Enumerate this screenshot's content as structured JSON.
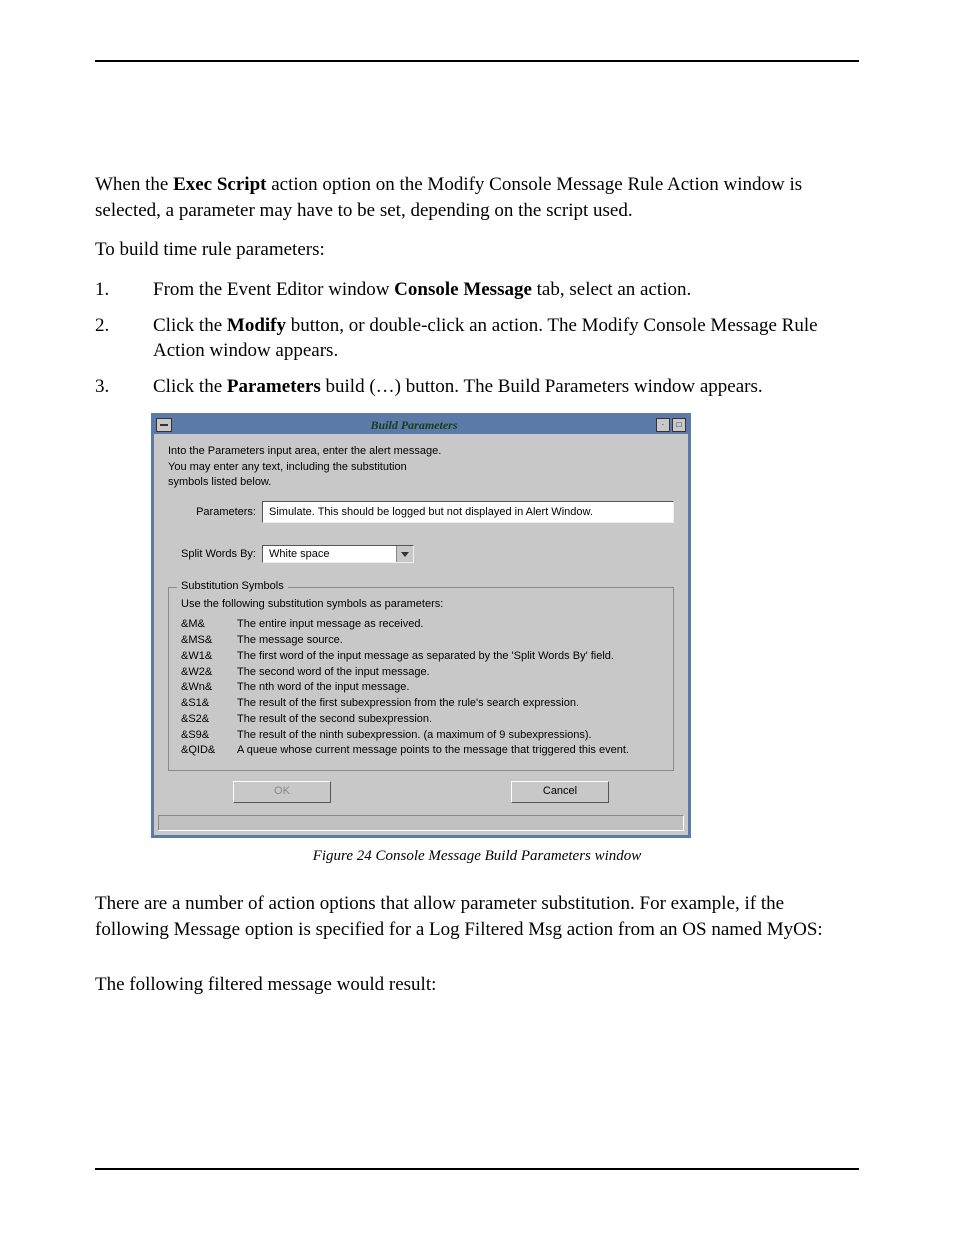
{
  "doc": {
    "p1_pre": "When the ",
    "p1_bold": "Exec Script",
    "p1_post": " action option on the Modify Console Message Rule Action window is selected, a parameter may have to be set, depending on the script used.",
    "p2": "To build time rule parameters:",
    "step1_pre": "From the Event Editor window ",
    "step1_bold": "Console Message",
    "step1_post": " tab, select an action.",
    "step2_pre": "Click the ",
    "step2_bold": "Modify",
    "step2_post": " button, or double-click an action. The Modify Console Message Rule Action window appears.",
    "step3_pre": "Click the ",
    "step3_bold": "Parameters",
    "step3_post": " build (…) button. The Build Parameters window appears.",
    "caption": "Figure 24 Console Message Build Parameters window",
    "p3": "There are a number of action options that allow parameter substitution. For example, if the following Message option is specified for a Log Filtered Msg action from an OS named MyOS:",
    "p4": "The following filtered message would result:",
    "num1": "1.",
    "num2": "2.",
    "num3": "3."
  },
  "dialog": {
    "title": "Build Parameters",
    "intro1": "Into the Parameters input area, enter the alert message.",
    "intro2": "You may enter any text, including the substitution",
    "intro3": "symbols listed below.",
    "parameters_label": "Parameters:",
    "parameters_value": "Simulate.  This should be logged but not displayed in Alert Window.",
    "split_label": "Split Words By:",
    "split_value": "White space",
    "fieldset_legend": "Substitution Symbols",
    "fieldset_hint": "Use the following substitution symbols as parameters:",
    "symbols": [
      {
        "key": "&M&",
        "desc": "The entire input message as received."
      },
      {
        "key": "&MS&",
        "desc": "The message source."
      },
      {
        "key": "&W1&",
        "desc": "The first word of the input message as separated by the 'Split Words By' field."
      },
      {
        "key": "&W2&",
        "desc": "The second word of the input message."
      },
      {
        "key": "&Wn&",
        "desc": "The nth word of the input message."
      },
      {
        "key": "&S1&",
        "desc": "The result of the first subexpression from the rule's search expression."
      },
      {
        "key": "&S2&",
        "desc": "The result of the second subexpression."
      },
      {
        "key": "&S9&",
        "desc": "The result of the ninth subexpression. (a maximum of 9 subexpressions)."
      },
      {
        "key": "&QID&",
        "desc": "A queue whose current message points to the message that triggered this event."
      }
    ],
    "ok_label": "OK",
    "cancel_label": "Cancel"
  }
}
